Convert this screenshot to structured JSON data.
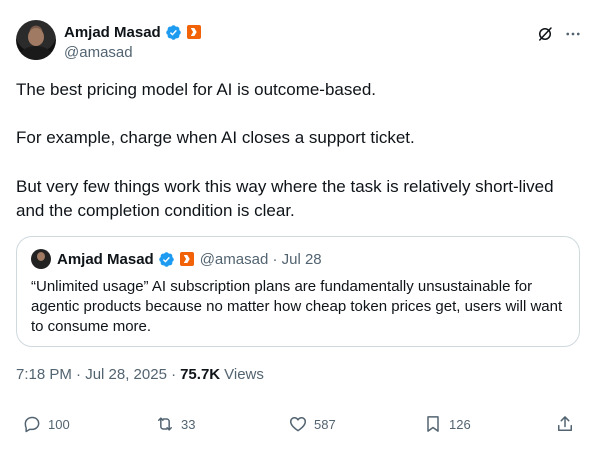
{
  "author": {
    "display_name": "Amjad Masad",
    "handle": "@amasad"
  },
  "tweet": {
    "paragraphs": [
      "The best pricing model for AI is outcome-based.",
      "For example, charge when AI closes a support ticket.",
      "But very few things work this way where the task is relatively short-lived and the completion condition is clear."
    ]
  },
  "quote": {
    "display_name": "Amjad Masad",
    "handle_date": "@amasad · Jul 28",
    "text": "“Unlimited usage” AI subscription plans are fundamentally unsustainable for agentic products because no matter how cheap token prices get, users will want to consume more."
  },
  "meta": {
    "timestamp": "7:18 PM · Jul 28, 2025 ·",
    "views_count": "75.7K",
    "views_label": "Views"
  },
  "actions": {
    "replies": "100",
    "reposts": "33",
    "likes": "587",
    "bookmarks": "126"
  },
  "colors": {
    "verified": "#1d9bf0",
    "brand_badge": "#f26207",
    "secondary_text": "#536471",
    "border": "#cfd9de"
  },
  "icons": {
    "header": [
      "grok-icon",
      "more-icon"
    ],
    "actions": [
      "reply-icon",
      "retweet-icon",
      "like-icon",
      "bookmark-icon",
      "share-icon"
    ]
  }
}
